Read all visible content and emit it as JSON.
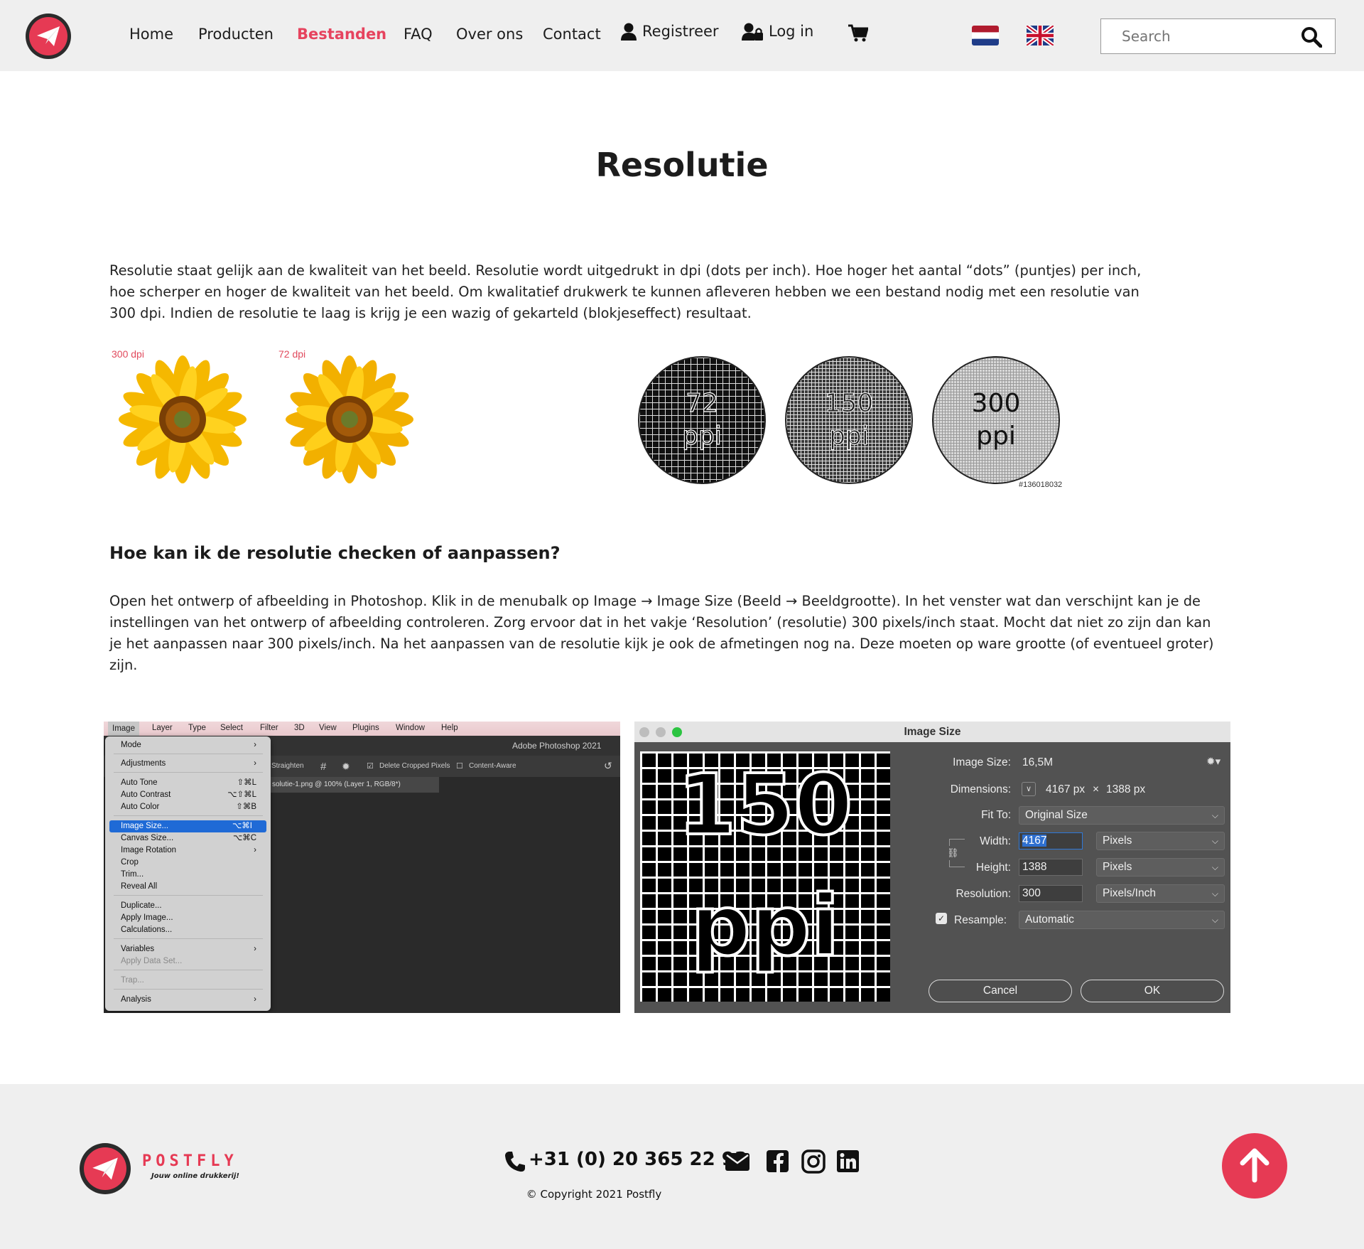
{
  "nav": {
    "items": [
      {
        "label": "Home"
      },
      {
        "label": "Producten"
      },
      {
        "label": "Bestanden"
      },
      {
        "label": "FAQ"
      },
      {
        "label": "Over ons"
      },
      {
        "label": "Contact"
      },
      {
        "label": "Registreer",
        "icon": "user-icon"
      },
      {
        "label": "Log in",
        "icon": "user-lock-icon"
      }
    ],
    "active": "Bestanden",
    "cart_icon": "cart-icon",
    "languages": [
      "nl-flag-icon",
      "uk-flag-icon"
    ]
  },
  "search": {
    "placeholder": "Search",
    "icon": "search-icon"
  },
  "colors": {
    "accent": "#e6435e",
    "header_bg": "#efefef",
    "footer_bg": "#efefef"
  },
  "main": {
    "title": "Resolutie",
    "intro": "Resolutie staat gelijk aan de kwaliteit van het beeld. Resolutie wordt uitgedrukt in dpi (dots per inch). Hoe hoger het aantal “dots” (puntjes) per inch, hoe scherper en hoger de kwaliteit van het beeld. Om kwalitatief drukwerk te kunnen afleveren hebben we een bestand nodig met een resolutie van 300 dpi. Indien de resolutie te laag is krijg je een wazig of gekarteld (blokjeseffect) resultaat.",
    "sunflowers": [
      {
        "label": "300 dpi"
      },
      {
        "label": "72 dpi"
      }
    ],
    "circles": [
      {
        "number": "72",
        "unit": "ppi"
      },
      {
        "number": "150",
        "unit": "ppi"
      },
      {
        "number": "300",
        "unit": "ppi"
      }
    ],
    "stock_id": "#136018032",
    "subheading": "Hoe kan ik de resolutie checken of aanpassen?",
    "instructions": "Open het ontwerp of afbeelding in Photoshop. Klik in de menubalk op Image → Image Size (Beeld → Beeldgrootte). In het venster wat dan verschijnt kan je de instellingen van het ontwerp of afbeelding controleren. Zorg ervoor dat in het vakje ‘Resolution’ (resolutie) 300 pixels/inch staat. Mocht dat niet zo zijn dan kan je het aanpassen naar 300 pixels/inch. Na het aanpassen van de resolutie kijk je ook de afmetingen nog na. Deze moeten op ware grootte (of eventueel groter) zijn."
  },
  "photoshop": {
    "menubar": [
      "Image",
      "Layer",
      "Type",
      "Select",
      "Filter",
      "3D",
      "View",
      "Plugins",
      "Window",
      "Help"
    ],
    "app_title": "Adobe Photoshop 2021",
    "options": [
      "Straighten",
      "Delete Cropped Pixels",
      "Content-Aware"
    ],
    "doc_tab": "solutie-1.png @ 100% (Layer 1, RGB/8*)",
    "menu": [
      {
        "label": "Mode",
        "shortcut": "›"
      },
      {
        "label": "Adjustments",
        "shortcut": "›"
      },
      {
        "label": "Auto Tone",
        "shortcut": "⇧⌘L"
      },
      {
        "label": "Auto Contrast",
        "shortcut": "⌥⇧⌘L"
      },
      {
        "label": "Auto Color",
        "shortcut": "⇧⌘B"
      },
      {
        "label": "Image Size...",
        "shortcut": "⌥⌘I",
        "highlighted": true
      },
      {
        "label": "Canvas Size...",
        "shortcut": "⌥⌘C"
      },
      {
        "label": "Image Rotation",
        "shortcut": "›"
      },
      {
        "label": "Crop",
        "shortcut": ""
      },
      {
        "label": "Trim...",
        "shortcut": ""
      },
      {
        "label": "Reveal All",
        "shortcut": ""
      },
      {
        "label": "Duplicate...",
        "shortcut": ""
      },
      {
        "label": "Apply Image...",
        "shortcut": ""
      },
      {
        "label": "Calculations...",
        "shortcut": ""
      },
      {
        "label": "Variables",
        "shortcut": "›"
      },
      {
        "label": "Apply Data Set...",
        "shortcut": "",
        "disabled": true
      },
      {
        "label": "Trap...",
        "shortcut": "",
        "disabled": true
      },
      {
        "label": "Analysis",
        "shortcut": "›"
      }
    ]
  },
  "image_size": {
    "title": "Image Size",
    "preview_number": "150",
    "preview_unit": "ppi",
    "image_size_label": "Image Size:",
    "image_size_value": "16,5M",
    "dimensions_label": "Dimensions:",
    "dimensions_width": "4167 px",
    "dimensions_x": "×",
    "dimensions_height": "1388 px",
    "fit_to_label": "Fit To:",
    "fit_to_value": "Original Size",
    "width_label": "Width:",
    "width_value": "4167",
    "width_unit": "Pixels",
    "height_label": "Height:",
    "height_value": "1388",
    "height_unit": "Pixels",
    "resolution_label": "Resolution:",
    "resolution_value": "300",
    "resolution_unit": "Pixels/Inch",
    "resample_label": "Resample:",
    "resample_value": "Automatic",
    "cancel": "Cancel",
    "ok": "OK"
  },
  "footer": {
    "brand": "POSTFLY",
    "tagline": "Jouw online drukkerij!",
    "phone": "+31 (0) 20 365 22 93",
    "social": [
      "mail-icon",
      "facebook-icon",
      "instagram-icon",
      "linkedin-icon"
    ],
    "copyright": "© Copyright 2021 Postfly"
  }
}
